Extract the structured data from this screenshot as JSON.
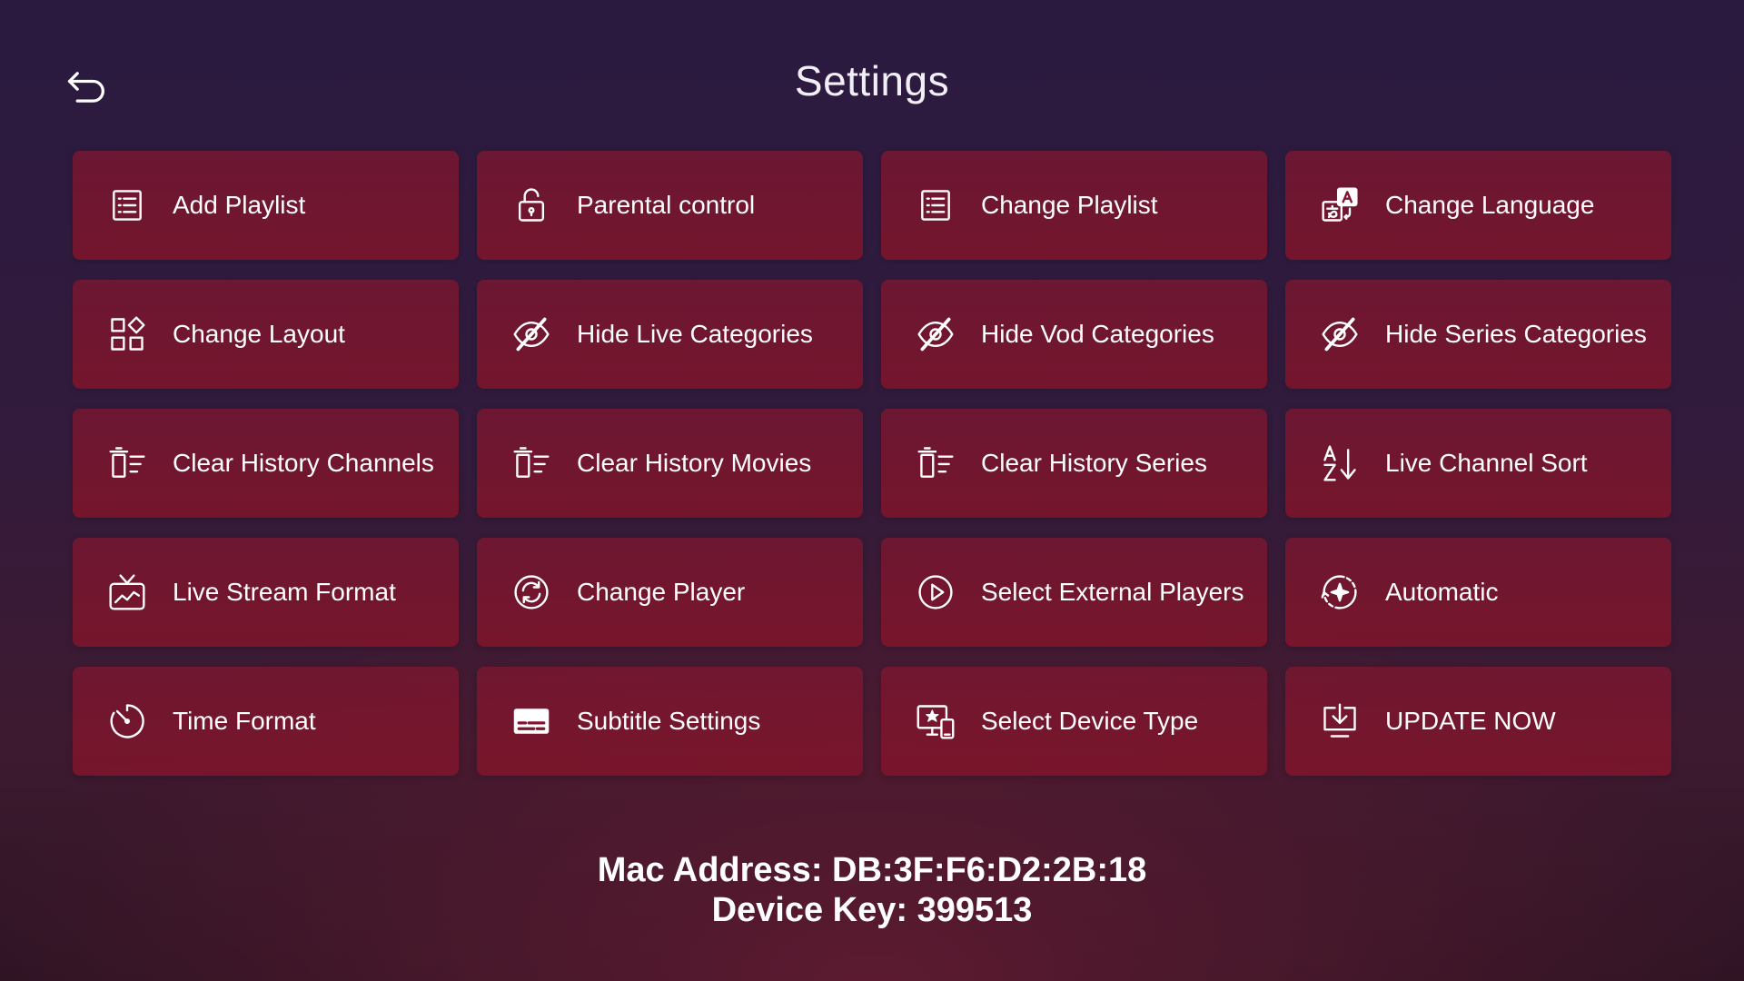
{
  "header": {
    "title": "Settings",
    "back_icon": "back-arrow-icon"
  },
  "tiles": [
    {
      "label": "Add Playlist",
      "icon": "list-icon"
    },
    {
      "label": "Parental control",
      "icon": "lock-icon"
    },
    {
      "label": "Change Playlist",
      "icon": "list-icon"
    },
    {
      "label": "Change Language",
      "icon": "translate-icon"
    },
    {
      "label": "Change Layout",
      "icon": "layout-icon"
    },
    {
      "label": "Hide Live Categories",
      "icon": "eye-off-icon"
    },
    {
      "label": "Hide Vod Categories",
      "icon": "eye-off-icon"
    },
    {
      "label": "Hide Series Categories",
      "icon": "eye-off-icon"
    },
    {
      "label": "Clear History Channels",
      "icon": "clear-list-icon"
    },
    {
      "label": "Clear History Movies",
      "icon": "clear-list-icon"
    },
    {
      "label": "Clear History Series",
      "icon": "clear-list-icon"
    },
    {
      "label": "Live Channel Sort",
      "icon": "sort-az-icon"
    },
    {
      "label": "Live Stream Format",
      "icon": "tv-icon"
    },
    {
      "label": "Change Player",
      "icon": "player-cycle-icon"
    },
    {
      "label": "Select External Players",
      "icon": "play-circle-icon"
    },
    {
      "label": "Automatic",
      "icon": "auto-icon"
    },
    {
      "label": "Time Format",
      "icon": "timer-icon"
    },
    {
      "label": "Subtitle Settings",
      "icon": "subtitles-icon"
    },
    {
      "label": "Select Device Type",
      "icon": "device-icon"
    },
    {
      "label": "UPDATE NOW",
      "icon": "download-icon"
    }
  ],
  "device": {
    "mac_line": "Mac Address: DB:3F:F6:D2:2B:18",
    "key_line": "Device Key: 399513"
  },
  "colors": {
    "tile_background": "#7e1630",
    "page_background_top": "#2a1a40",
    "page_background_bottom": "#3e1a30",
    "text": "#ffffff"
  }
}
